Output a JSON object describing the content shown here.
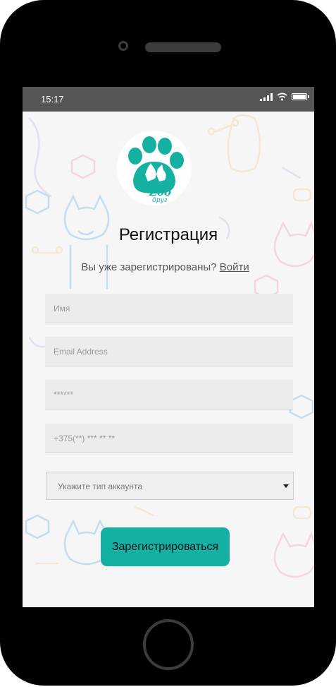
{
  "status_bar": {
    "time": "15:17"
  },
  "screen": {
    "title": "Регистрация",
    "login_prompt": "Вы уже зарегистрированы?",
    "login_link": "Войти"
  },
  "logo": {
    "word": "Zoo",
    "subword": "друг"
  },
  "form": {
    "name_placeholder": "Имя",
    "email_placeholder": "Email Address",
    "password_placeholder": "******",
    "phone_placeholder": "+375(**) *** ** **",
    "account_type_selected": "Укажите тип аккаунта",
    "submit_label": "Зарегистрироваться"
  },
  "colors": {
    "accent": "#14b0a2",
    "statusbar": "#555555"
  }
}
